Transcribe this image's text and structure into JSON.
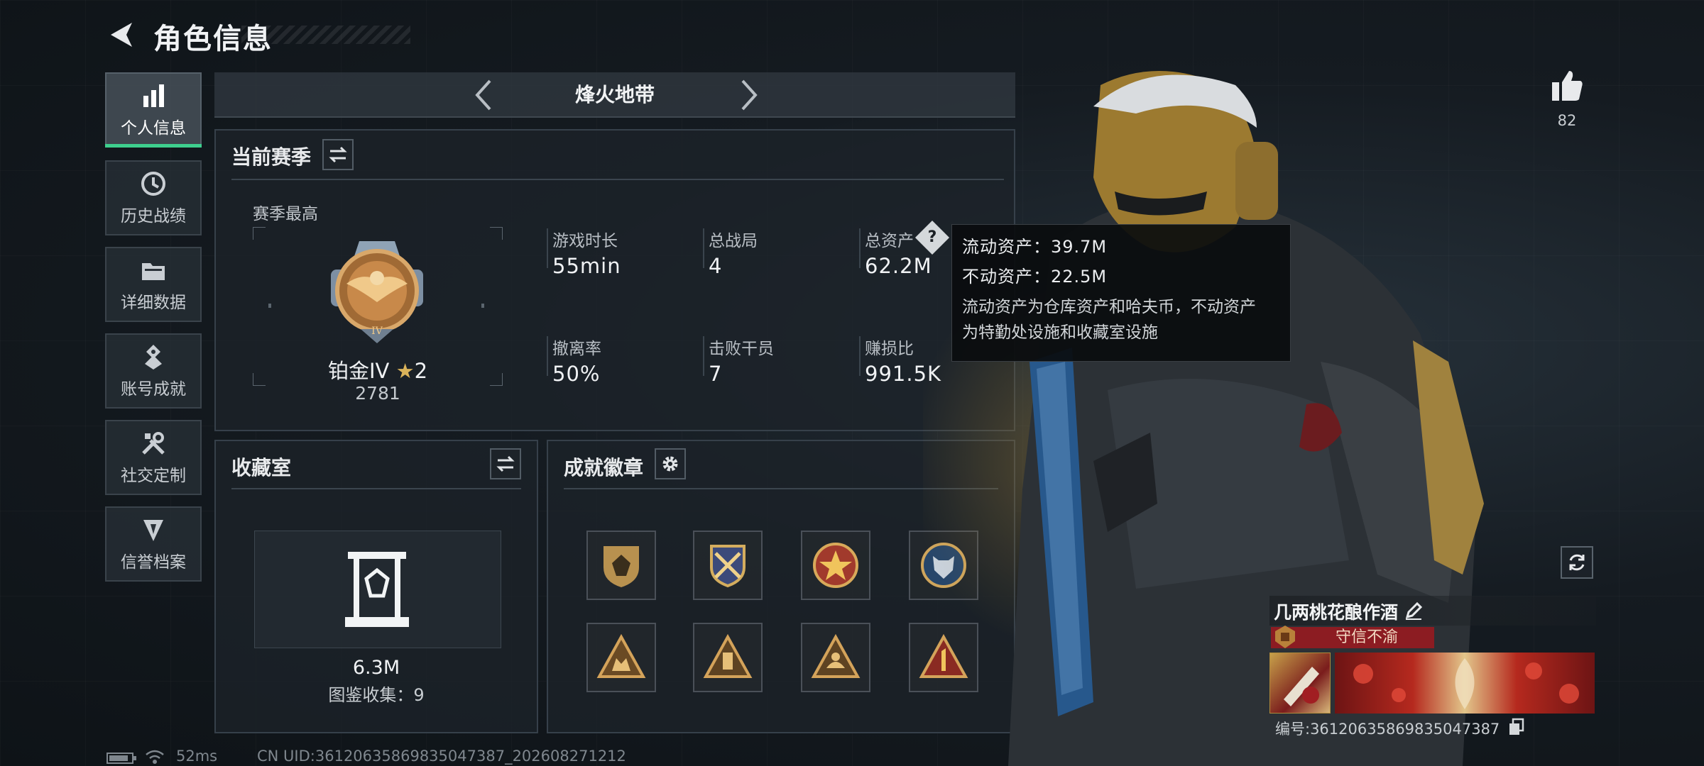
{
  "header": {
    "title": "角色信息"
  },
  "sidebar": {
    "items": [
      {
        "label": "个人信息",
        "icon": "bar-chart-icon"
      },
      {
        "label": "历史战绩",
        "icon": "history-icon"
      },
      {
        "label": "详细数据",
        "icon": "folder-icon"
      },
      {
        "label": "账号成就",
        "icon": "achievement-icon"
      },
      {
        "label": "社交定制",
        "icon": "tools-icon"
      },
      {
        "label": "信誉档案",
        "icon": "reputation-icon"
      }
    ]
  },
  "mode": {
    "title": "烽火地带"
  },
  "season": {
    "title": "当前赛季",
    "best_label": "赛季最高",
    "rank_name": "铂金IV",
    "rank_stars": "2",
    "rank_score": "2781",
    "stats": [
      {
        "label": "游戏时长",
        "value": "55min"
      },
      {
        "label": "总战局",
        "value": "4"
      },
      {
        "label": "总资产",
        "value": "62.2M"
      },
      {
        "label": "撤离率",
        "value": "50%"
      },
      {
        "label": "击败干员",
        "value": "7"
      },
      {
        "label": "赚损比",
        "value": "991.5K"
      }
    ]
  },
  "tooltip": {
    "liquid": "流动资产：39.7M",
    "fixed": "不动资产：22.5M",
    "desc1": "流动资产为仓库资产和哈夫币，不动资产",
    "desc2": "为特勤处设施和收藏室设施"
  },
  "collection": {
    "title": "收藏室",
    "value": "6.3M",
    "count_text": "图鉴收集：9"
  },
  "badges": {
    "title": "成就徽章",
    "items": [
      "shield-badge",
      "crossed-swords-badge",
      "star-medal-badge",
      "wolf-badge",
      "triangle-team-badge",
      "triangle-tower-badge",
      "triangle-hand-badge",
      "triangle-number-one-badge"
    ]
  },
  "profile": {
    "likes": "82",
    "name": "几两桃花酿作酒",
    "reputation_tag": "守信不渝",
    "id_text": "编号:36120635869835047387"
  },
  "footer": {
    "ping": "52ms",
    "uid": "CN UID:36120635869835047387_202608271212"
  },
  "colors": {
    "accent": "#3ecf8e",
    "gold": "#c9a25a",
    "tag_red": "#8c1c22"
  }
}
